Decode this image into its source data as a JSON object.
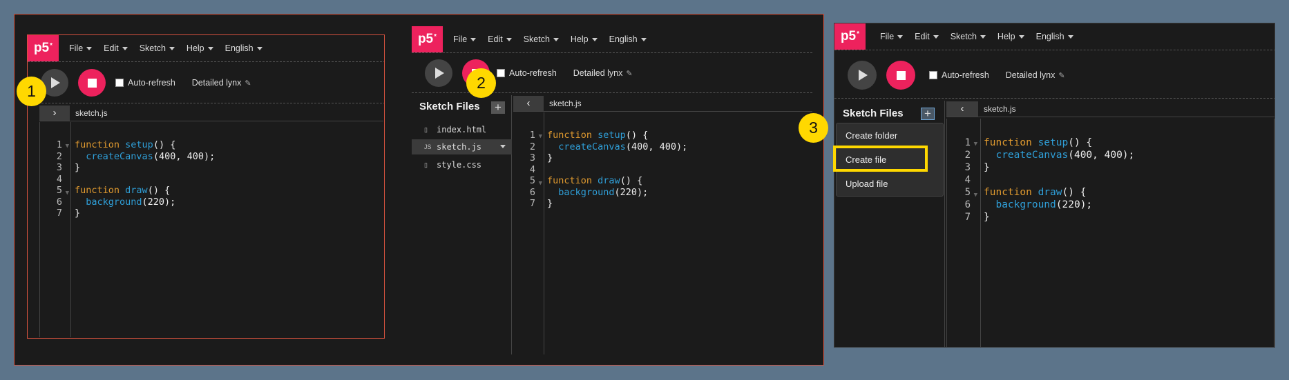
{
  "app": {
    "logo": "p5",
    "logo_sup": "*",
    "menus": [
      "File",
      "Edit",
      "Sketch",
      "Help",
      "English"
    ],
    "autorefresh_label": "Auto-refresh",
    "project_name": "Detailed lynx",
    "colors": {
      "brand": "#ed225d",
      "keyword": "#e09a2f",
      "function": "#2f9fd8",
      "highlight": "#ffd800"
    }
  },
  "editor": {
    "filename": "sketch.js",
    "line_numbers": [
      "1",
      "2",
      "3",
      "4",
      "5",
      "6",
      "7"
    ],
    "code": {
      "l1_kw": "function",
      "l1_fn": "setup",
      "l1_rest": "() {",
      "l2_fn": "createCanvas",
      "l2_rest": "(400, 400);",
      "l3": "}",
      "l5_kw": "function",
      "l5_fn": "draw",
      "l5_rest": "() {",
      "l6_fn": "background",
      "l6_rest": "(220);",
      "l7": "}"
    }
  },
  "sidebar": {
    "title": "Sketch Files",
    "files": [
      {
        "name": "index.html",
        "icon": "html-file-icon"
      },
      {
        "name": "sketch.js",
        "icon": "js-file-icon",
        "icon_text": "JS"
      },
      {
        "name": "style.css",
        "icon": "css-file-icon"
      }
    ]
  },
  "dropdown": {
    "items": [
      "Create folder",
      "Create file",
      "Upload file"
    ]
  },
  "steps": [
    "1",
    "2",
    "3"
  ]
}
